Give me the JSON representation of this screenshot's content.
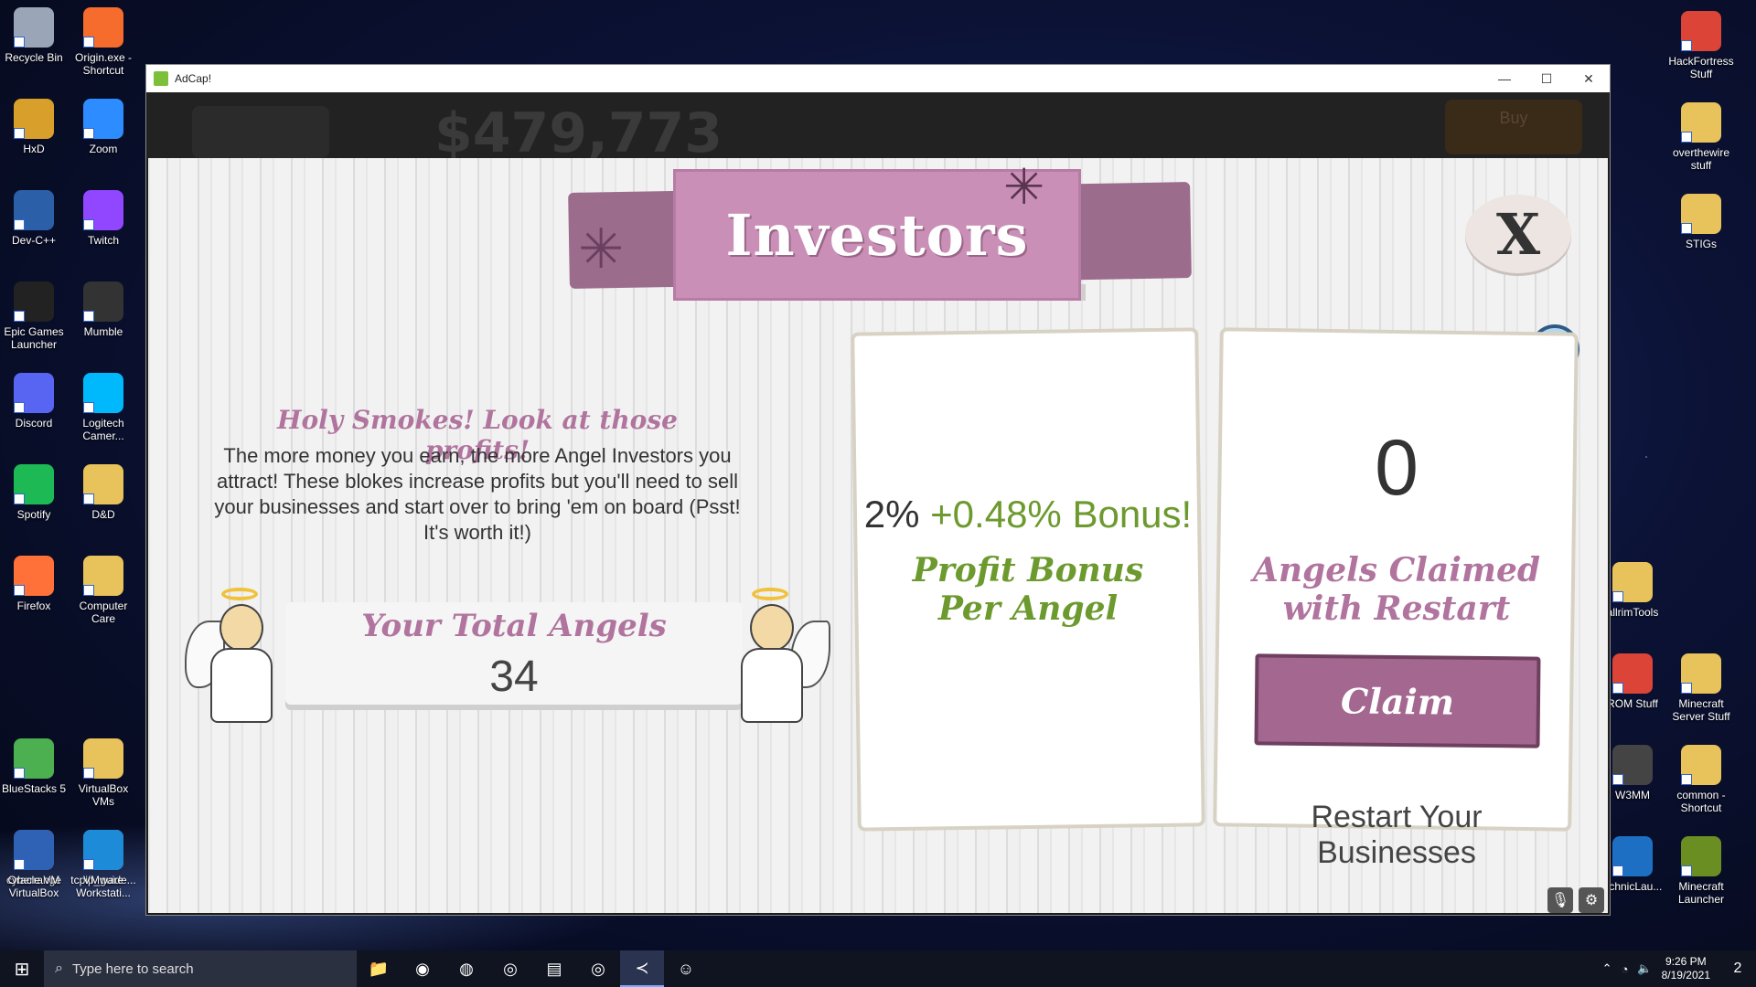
{
  "desktop": {
    "left_icons": [
      {
        "label": "Recycle Bin",
        "icon": "recycle-bin-icon",
        "color": "#9aa6b8"
      },
      {
        "label": "Origin.exe - Shortcut",
        "icon": "origin-icon",
        "color": "#f56c2d"
      },
      {
        "label": "HxD",
        "icon": "hxd-icon",
        "color": "#d8a02a"
      },
      {
        "label": "Zoom",
        "icon": "zoom-icon",
        "color": "#2d8cff"
      },
      {
        "label": "Dev-C++",
        "icon": "devcpp-icon",
        "color": "#2b5fa8"
      },
      {
        "label": "Twitch",
        "icon": "twitch-icon",
        "color": "#9146ff"
      },
      {
        "label": "Epic Games Launcher",
        "icon": "epic-games-icon",
        "color": "#222222"
      },
      {
        "label": "Mumble",
        "icon": "mumble-icon",
        "color": "#333333"
      },
      {
        "label": "Discord",
        "icon": "discord-icon",
        "color": "#5865f2"
      },
      {
        "label": "Logitech Camer...",
        "icon": "logitech-camera-icon",
        "color": "#00b8fc"
      },
      {
        "label": "Spotify",
        "icon": "spotify-icon",
        "color": "#1db954"
      },
      {
        "label": "D&D",
        "icon": "folder-icon",
        "color": "#e8c25a"
      },
      {
        "label": "Firefox",
        "icon": "firefox-icon",
        "color": "#ff7139"
      },
      {
        "label": "Computer Care",
        "icon": "folder-icon",
        "color": "#e8c25a"
      },
      {
        "label": "BlueStacks 5",
        "icon": "bluestacks-icon",
        "color": "#4caf50"
      },
      {
        "label": "VirtualBox VMs",
        "icon": "folder-icon",
        "color": "#e8c25a"
      },
      {
        "label": "cyberrange",
        "icon": "chrome-icon",
        "color": "#db4437"
      },
      {
        "label": "tcpip_guide...",
        "icon": "document-icon",
        "color": "#dddddd"
      },
      {
        "label": "Oracle VM VirtualBox",
        "icon": "virtualbox-icon",
        "color": "#2f61b4"
      },
      {
        "label": "VMware Workstati...",
        "icon": "vmware-icon",
        "color": "#1d8bd8"
      }
    ],
    "right_icons": [
      {
        "label": "HackFortress Stuff",
        "icon": "chrome-icon",
        "color": "#db4437"
      },
      {
        "label": "overthewire stuff",
        "icon": "folder-icon",
        "color": "#e8c25a"
      },
      {
        "label": "STIGs",
        "icon": "folder-icon",
        "color": "#e8c25a"
      },
      {
        "label": "allrimTools",
        "icon": "folder-icon",
        "color": "#e8c25a"
      },
      {
        "label": "ROM Stuff",
        "icon": "chrome-icon",
        "color": "#db4437"
      },
      {
        "label": "Minecraft Server Stuff",
        "icon": "folder-icon",
        "color": "#e8c25a"
      },
      {
        "label": "W3MM",
        "icon": "w3mm-icon",
        "color": "#444444"
      },
      {
        "label": "common - Shortcut",
        "icon": "folder-icon",
        "color": "#e8c25a"
      },
      {
        "label": "echnicLau...",
        "icon": "technic-launcher-icon",
        "color": "#1d6fc4"
      },
      {
        "label": "Minecraft Launcher",
        "icon": "minecraft-icon",
        "color": "#6b8e23"
      }
    ]
  },
  "window": {
    "title": "AdCap!",
    "minimize": "—",
    "maximize": "☐",
    "close": "✕"
  },
  "game": {
    "money_partial": "$479,773",
    "buy_label": "Buy",
    "panel_title": "Investors",
    "close_label": "X",
    "help_label": "?",
    "heading": "Holy Smokes! Look at those profits!",
    "description": "The more money you earn, the more Angel Investors you attract! These blokes increase profits but you'll need to sell your businesses and start over to bring 'em on board (Psst! It's worth it!)",
    "total_angels_label": "Your Total Angels",
    "total_angels_value": "34",
    "bonus_base": "2%",
    "bonus_extra": "+0.48% Bonus!",
    "profit_bonus_label_1": "Profit Bonus",
    "profit_bonus_label_2": "Per Angel",
    "angels_claimed_value": "0",
    "angels_claimed_label_1": "Angels Claimed",
    "angels_claimed_label_2": "with Restart",
    "claim_button": "Claim",
    "restart_label": "Restart Your Businesses"
  },
  "taskbar": {
    "search_placeholder": "Type here to search",
    "apps": [
      {
        "icon": "file-explorer-icon",
        "glyph": "📁"
      },
      {
        "icon": "chrome-icon",
        "glyph": "◉"
      },
      {
        "icon": "discord-icon",
        "glyph": "◍"
      },
      {
        "icon": "steam-icon",
        "glyph": "◎"
      },
      {
        "icon": "app-icon",
        "glyph": "▤"
      },
      {
        "icon": "steam-icon",
        "glyph": "◎"
      },
      {
        "icon": "vscode-icon",
        "glyph": "≺"
      },
      {
        "icon": "adcap-icon",
        "glyph": "☺"
      }
    ],
    "time": "9:26 PM",
    "date": "8/19/2021",
    "notification_count": "2"
  }
}
